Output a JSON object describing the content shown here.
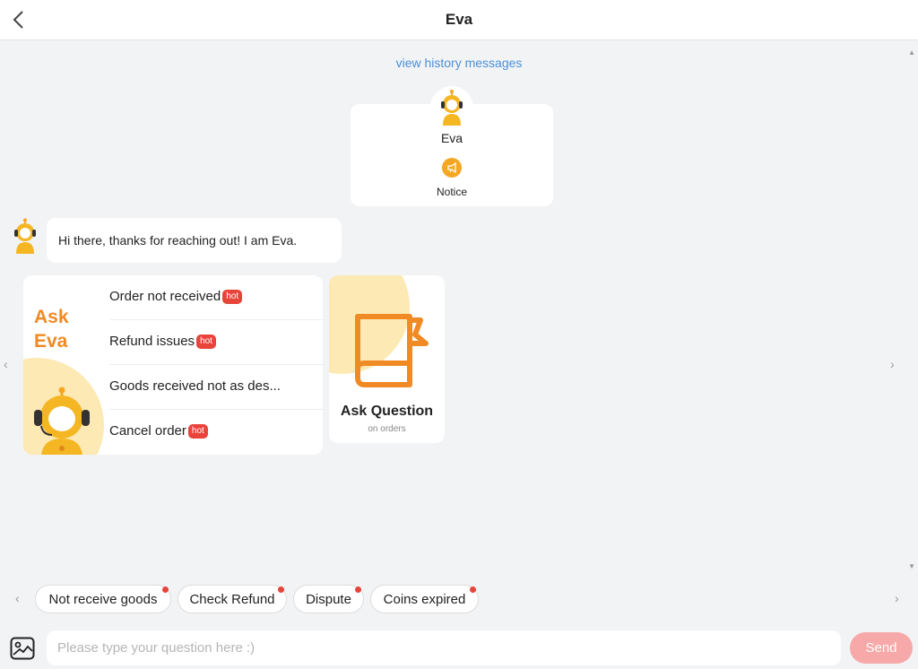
{
  "header": {
    "title": "Eva"
  },
  "history": {
    "link_label": "view history messages"
  },
  "profile": {
    "name": "Eva",
    "notice_label": "Notice"
  },
  "message": {
    "text": "Hi there, thanks for reaching out! I am Eva."
  },
  "ask_card": {
    "title": "Ask Eva",
    "items": [
      {
        "label": "Order not received",
        "badge": "hot"
      },
      {
        "label": "Refund issues",
        "badge": "hot"
      },
      {
        "label": "Goods received not as des...",
        "badge": ""
      },
      {
        "label": "Cancel order",
        "badge": "hot"
      }
    ]
  },
  "ask_question_card": {
    "title": "Ask Question",
    "subtitle": "on orders"
  },
  "quick_chips": [
    {
      "label": "Not receive goods"
    },
    {
      "label": "Check Refund"
    },
    {
      "label": "Dispute"
    },
    {
      "label": "Coins expired"
    }
  ],
  "input": {
    "placeholder": "Please type your question here :)",
    "value": ""
  },
  "send": {
    "label": "Send"
  },
  "colors": {
    "accent": "#f08a24",
    "hot": "#e8443a",
    "send_disabled": "#f7a8a8",
    "link": "#4a90d9"
  }
}
